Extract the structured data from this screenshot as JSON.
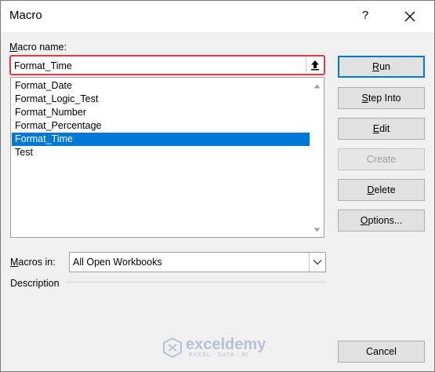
{
  "window": {
    "title": "Macro",
    "help_label": "?"
  },
  "macro_name": {
    "label": "Macro name:",
    "value": "Format_Time"
  },
  "macro_list": {
    "items": [
      "Format_Date",
      "Format_Logic_Test",
      "Format_Number",
      "Format_Percentage",
      "Format_Time",
      "Test"
    ],
    "selected": "Format_Time"
  },
  "macros_in": {
    "label": "Macros in:",
    "value": "All Open Workbooks"
  },
  "description": {
    "label": "Description"
  },
  "buttons": {
    "run": {
      "pre": "",
      "u": "R",
      "post": "un"
    },
    "step_into": {
      "pre": "",
      "u": "S",
      "post": "tep Into"
    },
    "edit": {
      "pre": "",
      "u": "E",
      "post": "dit"
    },
    "create": {
      "pre": "Create",
      "u": "",
      "post": ""
    },
    "delete": {
      "pre": "",
      "u": "D",
      "post": "elete"
    },
    "options": {
      "pre": "",
      "u": "O",
      "post": "ptions..."
    },
    "cancel": {
      "pre": "Cancel",
      "u": "",
      "post": ""
    }
  },
  "watermark": {
    "name": "exceldemy",
    "tagline": "EXCEL · DATA · BI"
  },
  "colors": {
    "selection": "#0078d7",
    "highlight_border": "#e23a44"
  }
}
